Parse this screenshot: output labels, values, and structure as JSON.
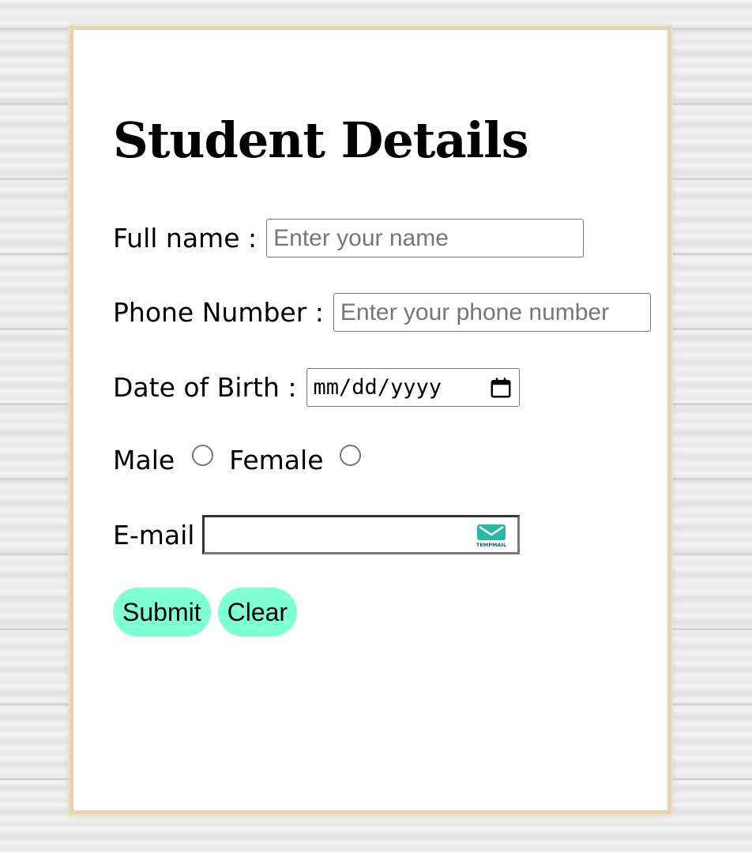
{
  "form": {
    "title": "Student Details",
    "fullname_label": "Full name :",
    "fullname_placeholder": "Enter your name",
    "phone_label": "Phone Number :",
    "phone_placeholder": "Enter your phone number",
    "dob_label": "Date of Birth :",
    "dob_placeholder": "mm/dd/yyyy",
    "gender_male_label": "Male",
    "gender_female_label": "Female",
    "email_label": "E-mail",
    "email_value": "",
    "email_extension_icon": "tempmail-icon",
    "email_extension_icon_text": "TEMPMAIL",
    "submit_label": "Submit",
    "clear_label": "Clear"
  },
  "colors": {
    "button_bg": "#7fffd4",
    "frame": "#e4d3b4",
    "tempmail_green": "#2bb8a3"
  }
}
